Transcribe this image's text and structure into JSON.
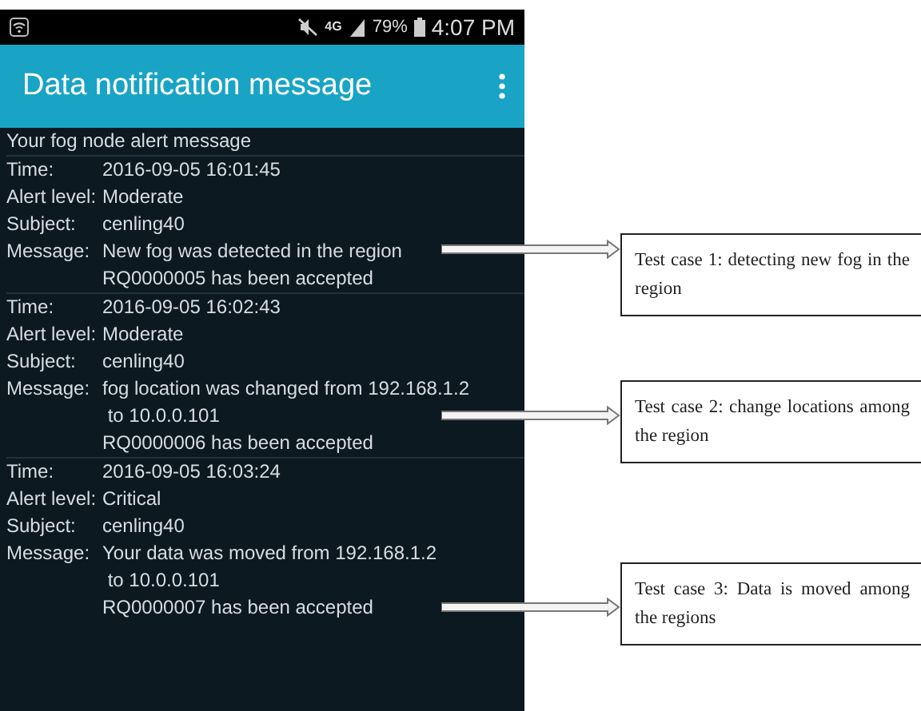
{
  "status_bar": {
    "network": "4G",
    "battery": "79%",
    "time": "4:07 PM"
  },
  "app_bar": {
    "title": "Data notification message"
  },
  "list": {
    "heading": "Your fog node alert message",
    "messages": [
      {
        "fields": [
          {
            "label": "Time:",
            "lines": [
              "2016-09-05 16:01:45"
            ]
          },
          {
            "label": "Alert level:",
            "lines": [
              "Moderate"
            ]
          },
          {
            "label": "Subject:",
            "lines": [
              "cenling40"
            ]
          },
          {
            "label": "Message:",
            "lines": [
              "New fog was detected in the region",
              "RQ0000005 has been accepted"
            ]
          }
        ]
      },
      {
        "fields": [
          {
            "label": "Time:",
            "lines": [
              "2016-09-05 16:02:43"
            ]
          },
          {
            "label": "Alert level:",
            "lines": [
              "Moderate"
            ]
          },
          {
            "label": "Subject:",
            "lines": [
              "cenling40"
            ]
          },
          {
            "label": "Message:",
            "lines": [
              "fog location was changed from 192.168.1.2",
              " to 10.0.0.101",
              "RQ0000006 has been accepted"
            ]
          }
        ]
      },
      {
        "fields": [
          {
            "label": "Time:",
            "lines": [
              "2016-09-05 16:03:24"
            ]
          },
          {
            "label": "Alert level:",
            "lines": [
              "Critical"
            ]
          },
          {
            "label": "Subject:",
            "lines": [
              "cenling40"
            ]
          },
          {
            "label": "Message:",
            "lines": [
              "Your data was moved from 192.168.1.2",
              " to 10.0.0.101",
              "RQ0000007 has been accepted"
            ]
          }
        ]
      }
    ]
  },
  "annotations": [
    {
      "text": "Test case 1: detecting new fog in the region"
    },
    {
      "text": "Test case 2: change locations among the region"
    },
    {
      "text": "Test case 3: Data is moved among the regions"
    }
  ]
}
